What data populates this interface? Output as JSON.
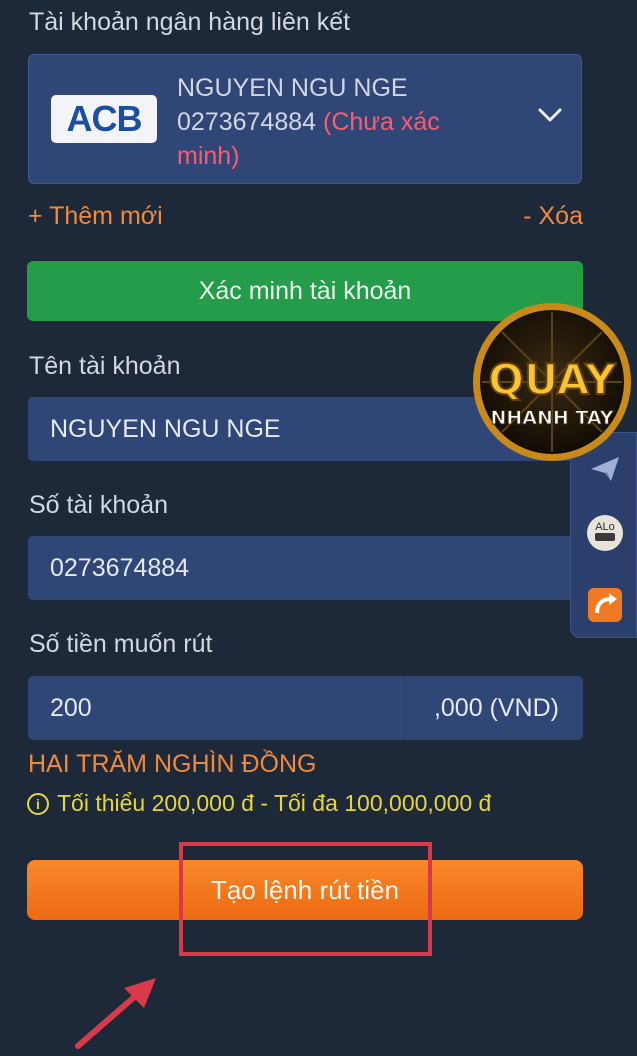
{
  "linked_accounts_label": "Tài khoản ngân hàng liên kết",
  "bank_card": {
    "logo_text": "ACB",
    "holder": "NGUYEN NGU NGE",
    "number": "0273674884",
    "status": "(Chưa xác minh)"
  },
  "add_new_link": "+ Thêm mới",
  "delete_link": "- Xóa",
  "verify_button": "Xác minh tài khoản",
  "account_name_label": "Tên tài khoản",
  "account_name_value": "NGUYEN NGU NGE",
  "account_number_label": "Số tài khoản",
  "account_number_value": "0273674884",
  "amount_label": "Số tiền muốn rút",
  "amount_value": "200",
  "amount_unit": ",000 (VND)",
  "amount_in_words": "HAI TRĂM NGHÌN ĐỒNG",
  "limits_text": "Tối thiểu 200,000 đ - Tối đa 100,000,000 đ",
  "submit_button": "Tạo lệnh rút tiền",
  "promo_badge": {
    "line1": "QUAY",
    "line2": "NHANH TAY"
  },
  "side_rail": {
    "items": [
      {
        "icon": "paper-plane-icon"
      },
      {
        "icon": "zalo-icon",
        "label": "ALo"
      },
      {
        "icon": "share-arrow-icon"
      }
    ]
  },
  "colors": {
    "background": "#1d2838",
    "field": "#2f4677",
    "accent_orange": "#f08a3a",
    "green": "#259c49",
    "warning_yellow": "#e6d63a",
    "annotation_red": "#d93a4b"
  }
}
